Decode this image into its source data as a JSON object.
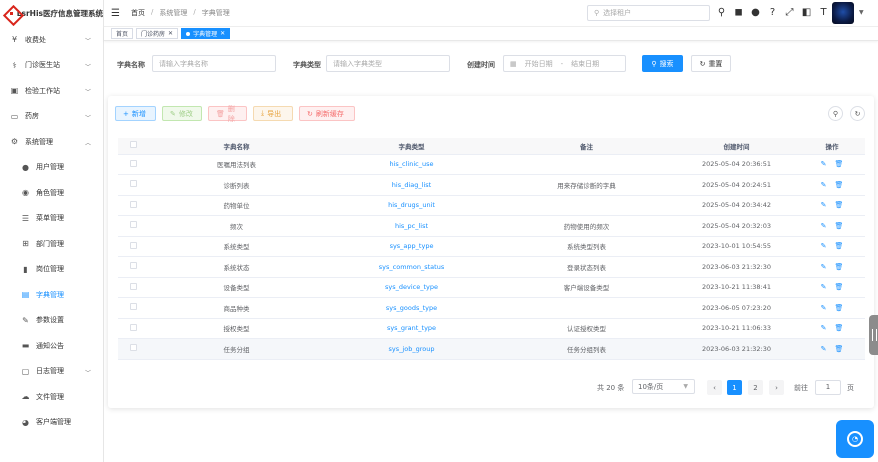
{
  "app": {
    "title": "LsrHis医疗信息管理系统"
  },
  "sidebar": {
    "items": [
      {
        "label": "收费处",
        "icon": "yen-icon",
        "glyph": "¥",
        "chevron": true
      },
      {
        "label": "门诊医生站",
        "icon": "stethoscope-icon",
        "glyph": "⚕",
        "chevron": true
      },
      {
        "label": "检验工作站",
        "icon": "bus-icon",
        "glyph": "▣",
        "chevron": true
      },
      {
        "label": "药房",
        "icon": "monitor-icon",
        "glyph": "▭",
        "chevron": true
      },
      {
        "label": "系统管理",
        "icon": "gear-icon",
        "glyph": "⚙",
        "chevron": true,
        "expanded": true
      },
      {
        "label": "用户管理",
        "icon": "user-icon",
        "glyph": "●",
        "sub": true
      },
      {
        "label": "角色管理",
        "icon": "roles-icon",
        "glyph": "◉",
        "sub": true
      },
      {
        "label": "菜单管理",
        "icon": "menu-tree-icon",
        "glyph": "☰",
        "sub": true
      },
      {
        "label": "部门管理",
        "icon": "org-icon",
        "glyph": "⊞",
        "sub": true
      },
      {
        "label": "岗位管理",
        "icon": "post-icon",
        "glyph": "▮",
        "sub": true
      },
      {
        "label": "字典管理",
        "icon": "dictionary-icon",
        "glyph": "▤",
        "sub": true,
        "active": true
      },
      {
        "label": "参数设置",
        "icon": "edit-icon",
        "glyph": "✎",
        "sub": true
      },
      {
        "label": "通知公告",
        "icon": "message-icon",
        "glyph": "▬",
        "sub": true
      },
      {
        "label": "日志管理",
        "icon": "log-icon",
        "glyph": "▢",
        "sub": true,
        "chevron": true
      },
      {
        "label": "文件管理",
        "icon": "cloud-icon",
        "glyph": "☁",
        "sub": true
      },
      {
        "label": "客户端管理",
        "icon": "client-icon",
        "glyph": "◕",
        "sub": true
      }
    ]
  },
  "topbar": {
    "breadcrumb": [
      "首页",
      "系统管理",
      "字典管理"
    ],
    "user_select_placeholder": "选择租户"
  },
  "tags": [
    {
      "label": "首页",
      "closable": false,
      "active": false
    },
    {
      "label": "门诊药房",
      "closable": true,
      "active": false
    },
    {
      "label": "字典管理",
      "closable": true,
      "active": true
    }
  ],
  "search": {
    "name_label": "字典名称",
    "name_placeholder": "请输入字典名称",
    "type_label": "字典类型",
    "type_placeholder": "请输入字典类型",
    "date_label": "创建时间",
    "date_start": "开始日期",
    "date_sep": "-",
    "date_end": "结束日期",
    "search_btn": "搜索",
    "reset_btn": "重置"
  },
  "toolbar": {
    "add": "新增",
    "edit": "修改",
    "delete": "删除",
    "export": "导出",
    "refresh_cache": "刷新缓存"
  },
  "table": {
    "headers": [
      "",
      "字典名称",
      "字典类型",
      "备注",
      "创建时间",
      "操作"
    ],
    "rows": [
      {
        "name": "医嘱用法列表",
        "type": "his_clinic_use",
        "remark": "",
        "created": "2025-05-04 20:36:51"
      },
      {
        "name": "诊断列表",
        "type": "his_diag_list",
        "remark": "用来存储诊断的字典",
        "created": "2025-05-04 20:24:51"
      },
      {
        "name": "药物单位",
        "type": "his_drugs_unit",
        "remark": "",
        "created": "2025-05-04 20:34:42"
      },
      {
        "name": "频次",
        "type": "his_pc_list",
        "remark": "药物使用的频次",
        "created": "2025-05-04 20:32:03"
      },
      {
        "name": "系统类型",
        "type": "sys_app_type",
        "remark": "系统类型列表",
        "created": "2023-10-01 10:54:55"
      },
      {
        "name": "系统状态",
        "type": "sys_common_status",
        "remark": "登录状态列表",
        "created": "2023-06-03 21:32:30"
      },
      {
        "name": "设备类型",
        "type": "sys_device_type",
        "remark": "客户端设备类型",
        "created": "2023-10-21 11:38:41"
      },
      {
        "name": "商品种类",
        "type": "sys_goods_type",
        "remark": "",
        "created": "2023-06-05 07:23:20"
      },
      {
        "name": "授权类型",
        "type": "sys_grant_type",
        "remark": "认证授权类型",
        "created": "2023-10-21 11:06:33"
      },
      {
        "name": "任务分组",
        "type": "sys_job_group",
        "remark": "任务分组列表",
        "created": "2023-06-03 21:32:30"
      }
    ]
  },
  "pagination": {
    "total": "共 20 条",
    "page_size": "10条/页",
    "pages": [
      "1",
      "2"
    ],
    "current": "1",
    "goto_label": "前往",
    "goto_value": "1",
    "page_suffix": "页"
  },
  "colors": {
    "primary": "#1890ff",
    "danger": "#f56c6c",
    "warning": "#e6a23c",
    "success": "#67c23a"
  }
}
